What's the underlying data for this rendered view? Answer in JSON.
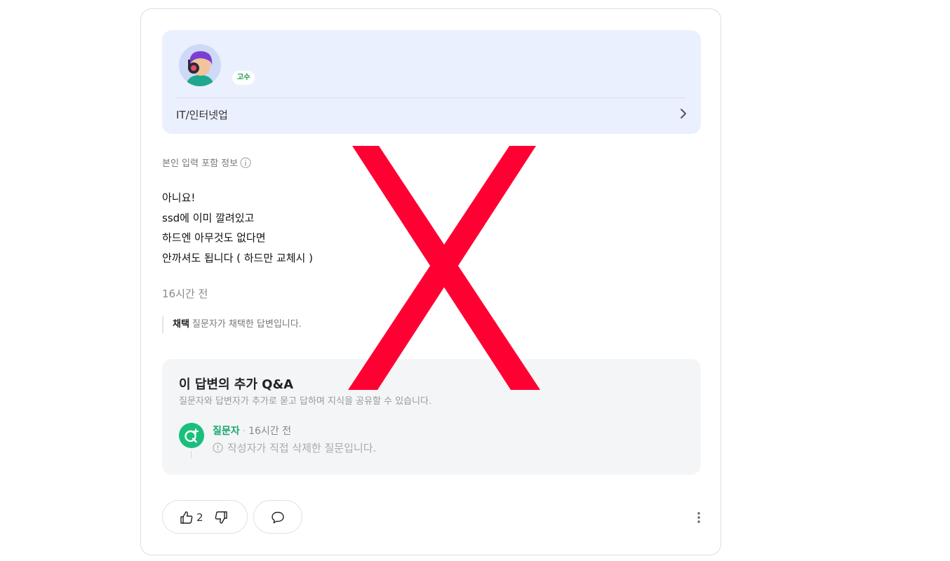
{
  "profile": {
    "badge": "고수",
    "category": "IT/인터넷업"
  },
  "info_label": "본인 입력 포함 정보",
  "answer": {
    "lines": [
      "아니요!",
      "ssd에 이미 깔려있고",
      "하드엔 아무것도 없다면",
      "안까셔도 됩니다 ( 하드만 교체시 )"
    ],
    "time_ago": "16시간 전"
  },
  "adoption": {
    "label": "채택",
    "text": "질문자가 채택한 답변입니다."
  },
  "qa": {
    "title": "이 답변의 추가 Q&A",
    "description": "질문자와 답변자가 추가로 묻고 답하며 지식을 공유할 수 있습니다.",
    "item": {
      "author": "질문자",
      "time": "16시간 전",
      "deleted_text": "작성자가 직접 삭제한 질문입니다."
    }
  },
  "actions": {
    "like_count": "2"
  },
  "colors": {
    "profile_bg": "#ebf0ff",
    "accent_green": "#19c07c",
    "overlay_red": "#ff0033"
  },
  "overlay": {
    "icon": "red-x-mark"
  }
}
